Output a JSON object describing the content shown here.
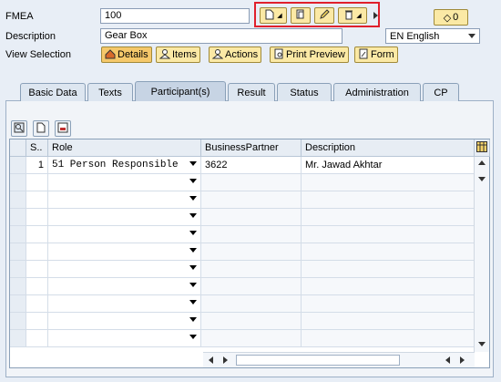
{
  "header": {
    "fmea_label": "FMEA",
    "fmea_value": "100",
    "description_label": "Description",
    "description_value": "Gear Box",
    "view_selection_label": "View Selection",
    "language_value": "EN English",
    "status_button": "0"
  },
  "view_buttons": [
    {
      "label": "Details",
      "icon": "details-icon"
    },
    {
      "label": "Items",
      "icon": "items-icon"
    },
    {
      "label": "Actions",
      "icon": "actions-icon"
    },
    {
      "label": "Print Preview",
      "icon": "print-preview-icon"
    },
    {
      "label": "Form",
      "icon": "form-icon"
    }
  ],
  "tabs": [
    "Basic Data",
    "Texts",
    "Participant(s)",
    "Result",
    "Status",
    "Administration",
    "CP"
  ],
  "active_tab": "Participant(s)",
  "table": {
    "columns": [
      "S..",
      "Role",
      "BusinessPartner",
      "Description"
    ],
    "rows": [
      {
        "seq": "1",
        "role": "51 Person Responsible",
        "partner": "3622",
        "description": "Mr. Jawad Akhtar"
      }
    ]
  },
  "colors": {
    "accent": "#fbe9a5",
    "highlight": "#e0202c",
    "background": "#e8eef6"
  }
}
